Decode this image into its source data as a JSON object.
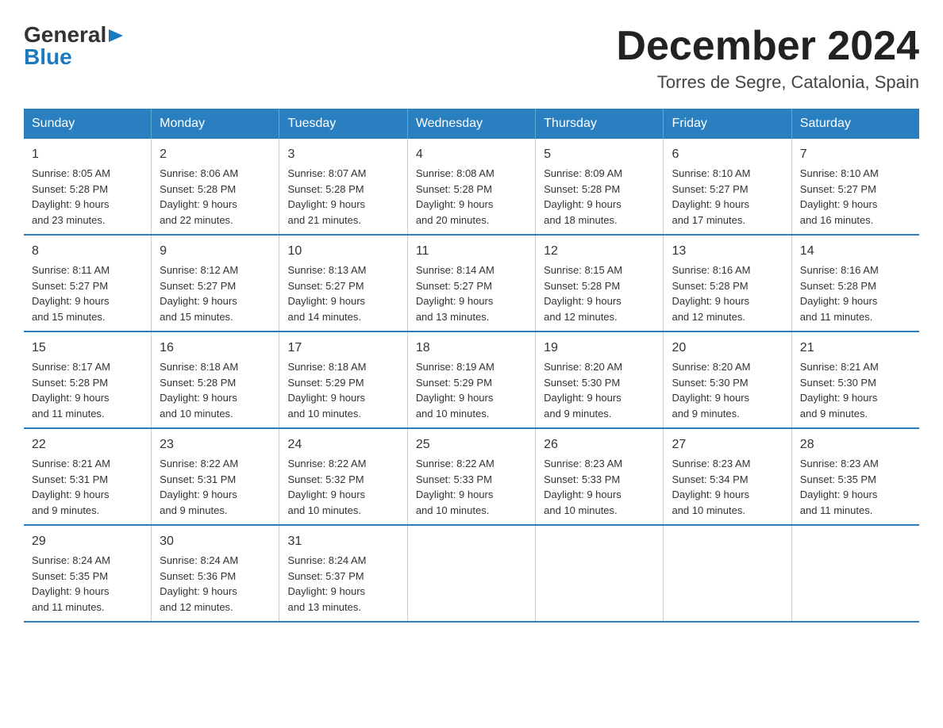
{
  "logo": {
    "general": "General",
    "blue": "Blue"
  },
  "title": "December 2024",
  "subtitle": "Torres de Segre, Catalonia, Spain",
  "days_of_week": [
    "Sunday",
    "Monday",
    "Tuesday",
    "Wednesday",
    "Thursday",
    "Friday",
    "Saturday"
  ],
  "weeks": [
    [
      {
        "day": "1",
        "info": "Sunrise: 8:05 AM\nSunset: 5:28 PM\nDaylight: 9 hours\nand 23 minutes."
      },
      {
        "day": "2",
        "info": "Sunrise: 8:06 AM\nSunset: 5:28 PM\nDaylight: 9 hours\nand 22 minutes."
      },
      {
        "day": "3",
        "info": "Sunrise: 8:07 AM\nSunset: 5:28 PM\nDaylight: 9 hours\nand 21 minutes."
      },
      {
        "day": "4",
        "info": "Sunrise: 8:08 AM\nSunset: 5:28 PM\nDaylight: 9 hours\nand 20 minutes."
      },
      {
        "day": "5",
        "info": "Sunrise: 8:09 AM\nSunset: 5:28 PM\nDaylight: 9 hours\nand 18 minutes."
      },
      {
        "day": "6",
        "info": "Sunrise: 8:10 AM\nSunset: 5:27 PM\nDaylight: 9 hours\nand 17 minutes."
      },
      {
        "day": "7",
        "info": "Sunrise: 8:10 AM\nSunset: 5:27 PM\nDaylight: 9 hours\nand 16 minutes."
      }
    ],
    [
      {
        "day": "8",
        "info": "Sunrise: 8:11 AM\nSunset: 5:27 PM\nDaylight: 9 hours\nand 15 minutes."
      },
      {
        "day": "9",
        "info": "Sunrise: 8:12 AM\nSunset: 5:27 PM\nDaylight: 9 hours\nand 15 minutes."
      },
      {
        "day": "10",
        "info": "Sunrise: 8:13 AM\nSunset: 5:27 PM\nDaylight: 9 hours\nand 14 minutes."
      },
      {
        "day": "11",
        "info": "Sunrise: 8:14 AM\nSunset: 5:27 PM\nDaylight: 9 hours\nand 13 minutes."
      },
      {
        "day": "12",
        "info": "Sunrise: 8:15 AM\nSunset: 5:28 PM\nDaylight: 9 hours\nand 12 minutes."
      },
      {
        "day": "13",
        "info": "Sunrise: 8:16 AM\nSunset: 5:28 PM\nDaylight: 9 hours\nand 12 minutes."
      },
      {
        "day": "14",
        "info": "Sunrise: 8:16 AM\nSunset: 5:28 PM\nDaylight: 9 hours\nand 11 minutes."
      }
    ],
    [
      {
        "day": "15",
        "info": "Sunrise: 8:17 AM\nSunset: 5:28 PM\nDaylight: 9 hours\nand 11 minutes."
      },
      {
        "day": "16",
        "info": "Sunrise: 8:18 AM\nSunset: 5:28 PM\nDaylight: 9 hours\nand 10 minutes."
      },
      {
        "day": "17",
        "info": "Sunrise: 8:18 AM\nSunset: 5:29 PM\nDaylight: 9 hours\nand 10 minutes."
      },
      {
        "day": "18",
        "info": "Sunrise: 8:19 AM\nSunset: 5:29 PM\nDaylight: 9 hours\nand 10 minutes."
      },
      {
        "day": "19",
        "info": "Sunrise: 8:20 AM\nSunset: 5:30 PM\nDaylight: 9 hours\nand 9 minutes."
      },
      {
        "day": "20",
        "info": "Sunrise: 8:20 AM\nSunset: 5:30 PM\nDaylight: 9 hours\nand 9 minutes."
      },
      {
        "day": "21",
        "info": "Sunrise: 8:21 AM\nSunset: 5:30 PM\nDaylight: 9 hours\nand 9 minutes."
      }
    ],
    [
      {
        "day": "22",
        "info": "Sunrise: 8:21 AM\nSunset: 5:31 PM\nDaylight: 9 hours\nand 9 minutes."
      },
      {
        "day": "23",
        "info": "Sunrise: 8:22 AM\nSunset: 5:31 PM\nDaylight: 9 hours\nand 9 minutes."
      },
      {
        "day": "24",
        "info": "Sunrise: 8:22 AM\nSunset: 5:32 PM\nDaylight: 9 hours\nand 10 minutes."
      },
      {
        "day": "25",
        "info": "Sunrise: 8:22 AM\nSunset: 5:33 PM\nDaylight: 9 hours\nand 10 minutes."
      },
      {
        "day": "26",
        "info": "Sunrise: 8:23 AM\nSunset: 5:33 PM\nDaylight: 9 hours\nand 10 minutes."
      },
      {
        "day": "27",
        "info": "Sunrise: 8:23 AM\nSunset: 5:34 PM\nDaylight: 9 hours\nand 10 minutes."
      },
      {
        "day": "28",
        "info": "Sunrise: 8:23 AM\nSunset: 5:35 PM\nDaylight: 9 hours\nand 11 minutes."
      }
    ],
    [
      {
        "day": "29",
        "info": "Sunrise: 8:24 AM\nSunset: 5:35 PM\nDaylight: 9 hours\nand 11 minutes."
      },
      {
        "day": "30",
        "info": "Sunrise: 8:24 AM\nSunset: 5:36 PM\nDaylight: 9 hours\nand 12 minutes."
      },
      {
        "day": "31",
        "info": "Sunrise: 8:24 AM\nSunset: 5:37 PM\nDaylight: 9 hours\nand 13 minutes."
      },
      {
        "day": "",
        "info": ""
      },
      {
        "day": "",
        "info": ""
      },
      {
        "day": "",
        "info": ""
      },
      {
        "day": "",
        "info": ""
      }
    ]
  ]
}
